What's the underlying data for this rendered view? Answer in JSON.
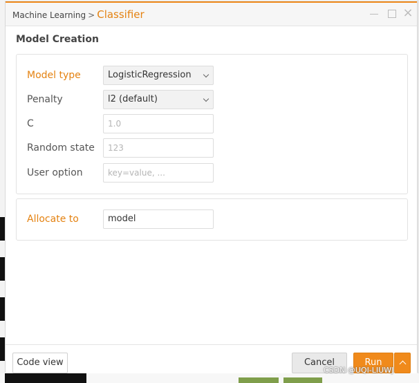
{
  "window": {
    "breadcrumb": "Machine Learning",
    "separator": ">",
    "title": "Classifier",
    "close_glyph": "×"
  },
  "section": {
    "title": "Model Creation"
  },
  "form": {
    "model_type": {
      "label": "Model type",
      "value": "LogisticRegression"
    },
    "penalty": {
      "label": "Penalty",
      "value": "l2 (default)"
    },
    "c": {
      "label": "C",
      "placeholder": "1.0"
    },
    "random_state": {
      "label": "Random state",
      "placeholder": "123"
    },
    "user_option": {
      "label": "User option",
      "placeholder": "key=value, ..."
    }
  },
  "allocate": {
    "label": "Allocate to",
    "value": "model"
  },
  "footer": {
    "code_view_label": "Code view",
    "cancel_label": "Cancel",
    "run_label": "Run"
  },
  "watermark": "CSDN @UQI-LIUWJ",
  "colors": {
    "accent": "#f08a1b",
    "accent_text": "#e48211"
  }
}
